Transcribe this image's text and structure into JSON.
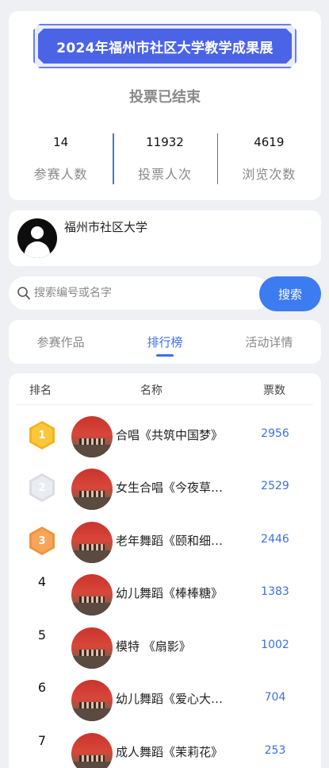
{
  "event": {
    "title": "2024年福州市社区大学教学成果展",
    "status": "投票已结束"
  },
  "stats": [
    {
      "value": "14",
      "label": "参赛人数"
    },
    {
      "value": "11932",
      "label": "投票人次"
    },
    {
      "value": "4619",
      "label": "浏览次数"
    }
  ],
  "organizer": {
    "name": "福州市社区大学"
  },
  "search": {
    "placeholder": "搜索编号或名字",
    "value": "",
    "button_label": "搜索"
  },
  "tabs": [
    {
      "label": "参赛作品",
      "active": false
    },
    {
      "label": "排行榜",
      "active": true
    },
    {
      "label": "活动详情",
      "active": false
    }
  ],
  "ranking": {
    "headers": {
      "rank": "排名",
      "name": "名称",
      "votes": "票数"
    },
    "rows": [
      {
        "rank": "1",
        "name": "合唱《共筑中国梦》",
        "votes": "2956"
      },
      {
        "rank": "2",
        "name": "女生合唱《今夜草…",
        "votes": "2529"
      },
      {
        "rank": "3",
        "name": "老年舞蹈《颐和细…",
        "votes": "2446"
      },
      {
        "rank": "4",
        "name": "幼儿舞蹈《棒棒糖》",
        "votes": "1383"
      },
      {
        "rank": "5",
        "name": "模特 《扇影》",
        "votes": "1002"
      },
      {
        "rank": "6",
        "name": "幼儿舞蹈《爱心大…",
        "votes": "704"
      },
      {
        "rank": "7",
        "name": "成人舞蹈《茉莉花》",
        "votes": "253"
      }
    ]
  },
  "colors": {
    "accent": "#3c6fe6",
    "banner": "#4b64e6",
    "button": "#3c7cf0"
  }
}
